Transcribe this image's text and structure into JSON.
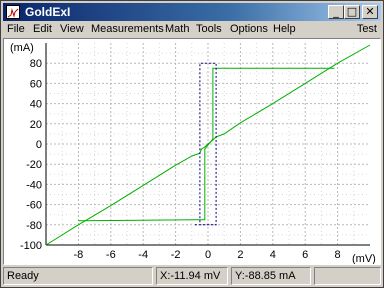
{
  "window": {
    "title": "GoldExI"
  },
  "title_buttons": {
    "minimize": "_",
    "maximize": "□",
    "close": "✕"
  },
  "menu": {
    "items": [
      "File",
      "Edit",
      "View",
      "Measurements",
      "Math",
      "Tools",
      "Options",
      "Help"
    ],
    "right_label": "Test"
  },
  "chart_data": {
    "type": "line",
    "ylabel": "(mA)",
    "xlabel": "(mV)",
    "xlim": [
      -10,
      10
    ],
    "ylim": [
      -100,
      100
    ],
    "x_ticks": [
      -8,
      -6,
      -4,
      -2,
      0,
      2,
      4,
      6,
      8
    ],
    "y_ticks": [
      80,
      60,
      40,
      20,
      0,
      -20,
      -40,
      -60,
      -80,
      -100
    ],
    "grid": true,
    "series": [
      {
        "color": "#00b000",
        "style": "solid",
        "x": [
          -10,
          -8,
          -6,
          -4,
          -2,
          -1,
          -0.5,
          -0.4,
          -0.2,
          0,
          0.3,
          0.5,
          1,
          2,
          4,
          6,
          8,
          10
        ],
        "y": [
          -100,
          -80,
          -61,
          -41,
          -21,
          -12,
          -9,
          -5,
          -3,
          0,
          4,
          7,
          10,
          21,
          40,
          60,
          80,
          98
        ]
      },
      {
        "color": "#00b000",
        "style": "solid",
        "x": [
          -8,
          -0.8,
          -0.2,
          -0.2,
          0.3,
          0.3,
          7.8
        ],
        "y": [
          -76,
          -75,
          -75,
          -5,
          5,
          75,
          75
        ]
      },
      {
        "color": "#000080",
        "style": "dashed",
        "x": [
          -0.8,
          0.5,
          0.5,
          -0.5,
          -0.5,
          0.5
        ],
        "y": [
          -80,
          -80,
          80,
          80,
          -80,
          -80
        ]
      }
    ]
  },
  "status": {
    "ready": "Ready",
    "x_readout": "X:-11.94 mV",
    "y_readout": "Y:-88.85 mA"
  }
}
